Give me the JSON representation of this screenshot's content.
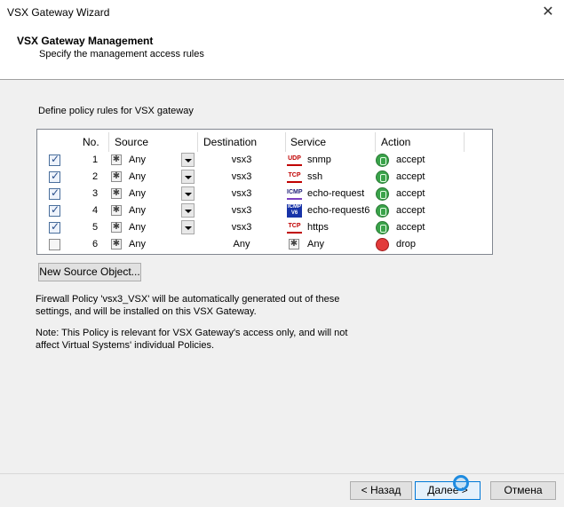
{
  "window": {
    "title": "VSX Gateway Wizard"
  },
  "header": {
    "title": "VSX Gateway Management",
    "subtitle": "Specify the management access rules"
  },
  "policy": {
    "label": "Define policy rules for VSX gateway",
    "columns": [
      "No.",
      "Source",
      "Destination",
      "Service",
      "Action"
    ],
    "rows": [
      {
        "checked": true,
        "no": "1",
        "source": "Any",
        "destination": "vsx3",
        "service_badge": "UDP",
        "service": "snmp",
        "action": "accept"
      },
      {
        "checked": true,
        "no": "2",
        "source": "Any",
        "destination": "vsx3",
        "service_badge": "TCP",
        "service": "ssh",
        "action": "accept"
      },
      {
        "checked": true,
        "no": "3",
        "source": "Any",
        "destination": "vsx3",
        "service_badge": "ICMP",
        "service": "echo-request",
        "action": "accept"
      },
      {
        "checked": true,
        "no": "4",
        "source": "Any",
        "destination": "vsx3",
        "service_badge": "ICMP V6",
        "service": "echo-request6",
        "action": "accept"
      },
      {
        "checked": true,
        "no": "5",
        "source": "Any",
        "destination": "vsx3",
        "service_badge": "TCP",
        "service": "https",
        "action": "accept"
      },
      {
        "checked": false,
        "no": "6",
        "source": "Any",
        "destination": "Any",
        "service_badge": "",
        "service": "Any",
        "action": "drop"
      }
    ]
  },
  "buttons": {
    "new_source": "New Source Object...",
    "back": "< Назад",
    "next": "Далее >",
    "cancel": "Отмена"
  },
  "notes": {
    "line1": "Firewall Policy 'vsx3_VSX' will be automatically generated out of these settings, and will be installed on this VSX Gateway.",
    "line2": "Note: This Policy is relevant for VSX Gateway's access only, and will not affect Virtual Systems' individual Policies."
  },
  "colors": {
    "accept": "#3aa34a",
    "drop": "#e23b3b",
    "accent": "#0078d7"
  }
}
